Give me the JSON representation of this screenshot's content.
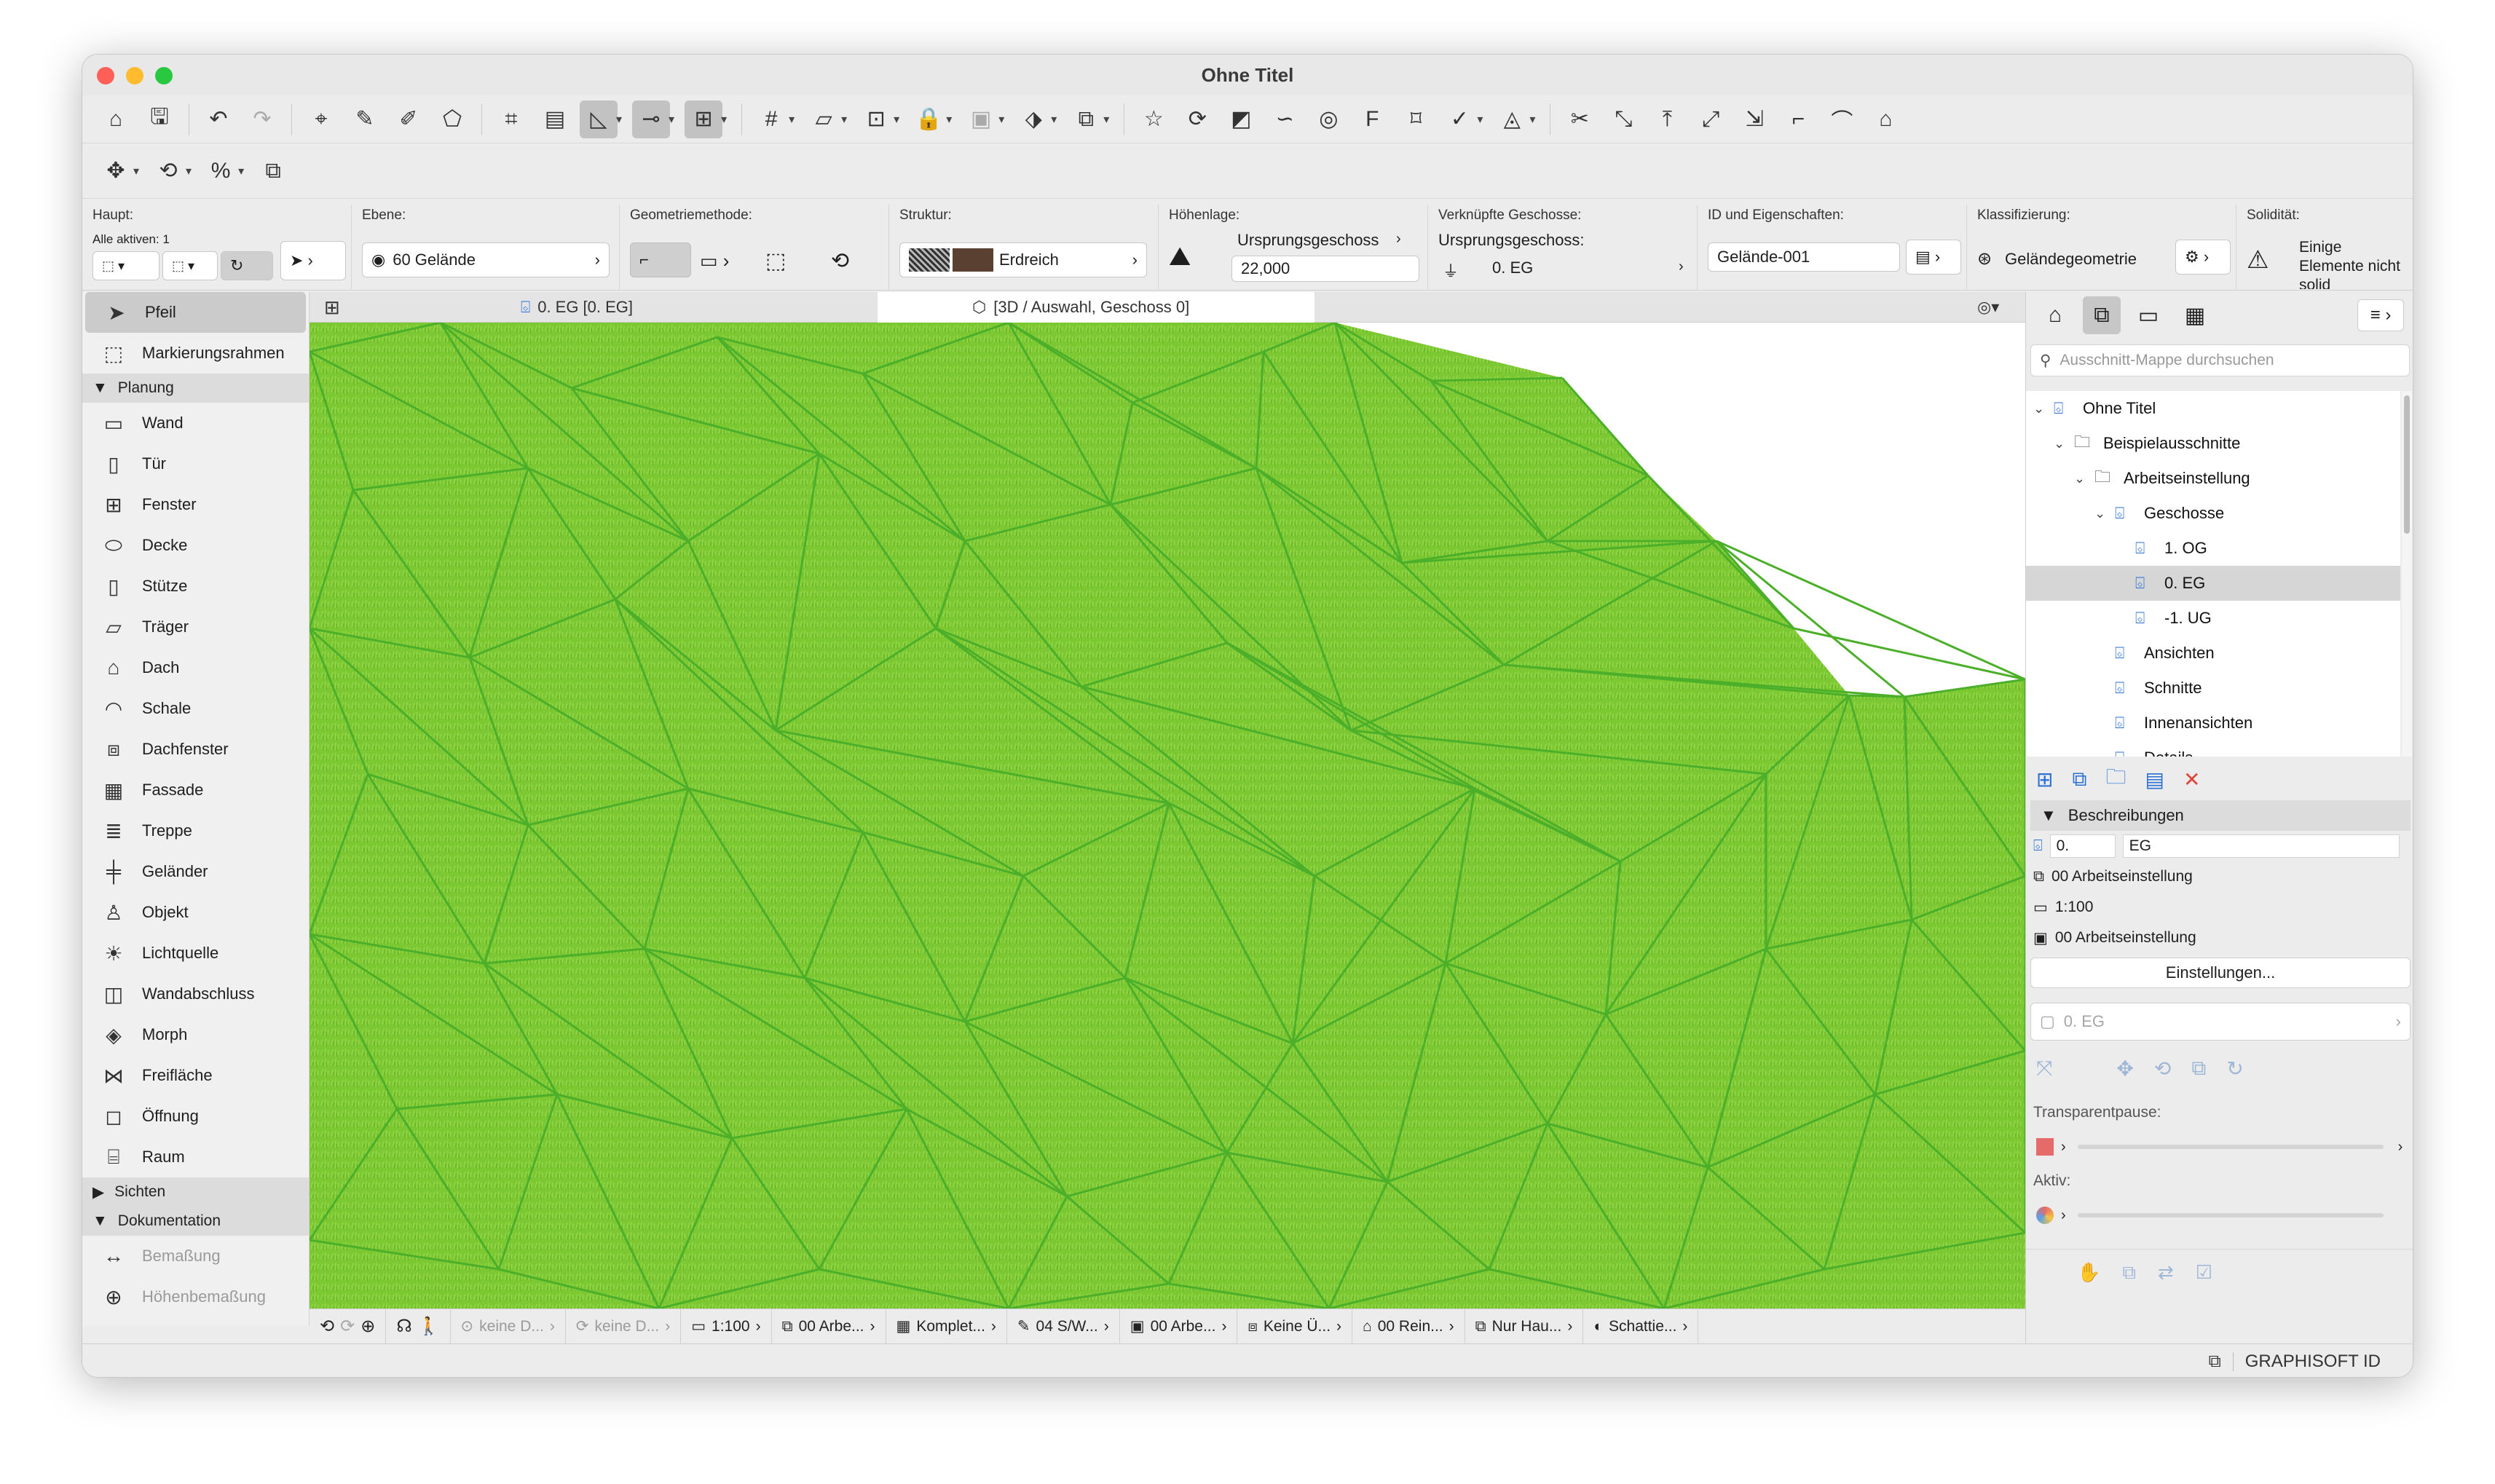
{
  "window": {
    "title": "Ohne Titel"
  },
  "infobox": {
    "haupt_label": "Haupt:",
    "haupt_sub": "Alle aktiven: 1",
    "ebene_label": "Ebene:",
    "ebene_value": "60 Gelände",
    "geometrie_label": "Geometriemethode:",
    "struktur_label": "Struktur:",
    "struktur_value": "Erdreich",
    "hoehe_label": "Höhenlage:",
    "hoehe_ref": "Ursprungsgeschoss",
    "hoehe_value": "22,000",
    "verkn_label": "Verknüpfte Geschosse:",
    "verkn_sub": "Ursprungsgeschoss:",
    "verkn_value": "0. EG",
    "id_label": "ID und Eigenschaften:",
    "id_value": "Gelände-001",
    "klass_label": "Klassifizierung:",
    "klass_value": "Geländegeometrie",
    "solid_label": "Solidität:",
    "solid_value": "Einige Elemente nicht solid"
  },
  "toolbox": {
    "top": [
      {
        "label": "Pfeil",
        "icon": "arrow-icon"
      },
      {
        "label": "Markierungsrahmen",
        "icon": "marquee-icon"
      }
    ],
    "planung_label": "Planung",
    "planung": [
      {
        "label": "Wand",
        "icon": "wall-icon"
      },
      {
        "label": "Tür",
        "icon": "door-icon"
      },
      {
        "label": "Fenster",
        "icon": "window-icon"
      },
      {
        "label": "Decke",
        "icon": "slab-icon"
      },
      {
        "label": "Stütze",
        "icon": "column-icon"
      },
      {
        "label": "Träger",
        "icon": "beam-icon"
      },
      {
        "label": "Dach",
        "icon": "roof-icon"
      },
      {
        "label": "Schale",
        "icon": "shell-icon"
      },
      {
        "label": "Dachfenster",
        "icon": "skylight-icon"
      },
      {
        "label": "Fassade",
        "icon": "curtain-wall-icon"
      },
      {
        "label": "Treppe",
        "icon": "stair-icon"
      },
      {
        "label": "Geländer",
        "icon": "railing-icon"
      },
      {
        "label": "Objekt",
        "icon": "object-icon"
      },
      {
        "label": "Lichtquelle",
        "icon": "lamp-icon"
      },
      {
        "label": "Wandabschluss",
        "icon": "wall-end-icon"
      },
      {
        "label": "Morph",
        "icon": "morph-icon"
      },
      {
        "label": "Freifläche",
        "icon": "mesh-icon"
      },
      {
        "label": "Öffnung",
        "icon": "opening-icon"
      },
      {
        "label": "Raum",
        "icon": "zone-icon"
      }
    ],
    "sichten_label": "Sichten",
    "dokumentation_label": "Dokumentation",
    "dokumentation": [
      {
        "label": "Bemaßung",
        "icon": "dimension-icon"
      },
      {
        "label": "Höhenbemaßung",
        "icon": "level-dimension-icon"
      }
    ]
  },
  "tabs": [
    {
      "label": "0. EG [0. EG]"
    },
    {
      "label": "[3D / Auswahl, Geschoss 0]"
    }
  ],
  "statusbar": [
    {
      "label": "keine D...",
      "dim": true
    },
    {
      "label": "keine D...",
      "dim": true
    },
    {
      "label": "1:100"
    },
    {
      "label": "00 Arbe..."
    },
    {
      "label": "Komplet..."
    },
    {
      "label": "04 S/W..."
    },
    {
      "label": "00 Arbe..."
    },
    {
      "label": "Keine Ü..."
    },
    {
      "label": "00 Rein..."
    },
    {
      "label": "Nur Hau..."
    },
    {
      "label": "Schattie..."
    }
  ],
  "navigator": {
    "search_placeholder": "Ausschnitt-Mappe durchsuchen",
    "tree": [
      {
        "label": "Ohne Titel",
        "level": 0,
        "chev": "v"
      },
      {
        "label": "Beispielausschnitte",
        "level": 1,
        "chev": "v"
      },
      {
        "label": "Arbeitseinstellung",
        "level": 2,
        "chev": "v"
      },
      {
        "label": "Geschosse",
        "level": 3,
        "chev": "v"
      },
      {
        "label": "1. OG",
        "level": 4,
        "chev": ""
      },
      {
        "label": "0. EG",
        "level": 4,
        "chev": "",
        "selected": true
      },
      {
        "label": "-1. UG",
        "level": 4,
        "chev": ""
      },
      {
        "label": "Ansichten",
        "level": 3,
        "chev": ""
      },
      {
        "label": "Schnitte",
        "level": 3,
        "chev": ""
      },
      {
        "label": "Innenansichten",
        "level": 3,
        "chev": ""
      },
      {
        "label": "Details",
        "level": 3,
        "chev": ""
      }
    ],
    "beschreibungen_label": "Beschreibungen",
    "desc_num": "0.",
    "desc_name": "EG",
    "prop1": "00 Arbeitseinstellung",
    "prop2": "1:100",
    "prop3": "00 Arbeitseinstellung",
    "settings_button": "Einstellungen...",
    "disabled_value": "0. EG",
    "transparent_label": "Transparentpause:",
    "aktiv_label": "Aktiv:"
  },
  "bottombar": {
    "brand": "GRAPHISOFT ID"
  },
  "colors": {
    "terrain": "#7cc832",
    "edges": "#4caf2a",
    "accent": "#2a6fd6"
  }
}
